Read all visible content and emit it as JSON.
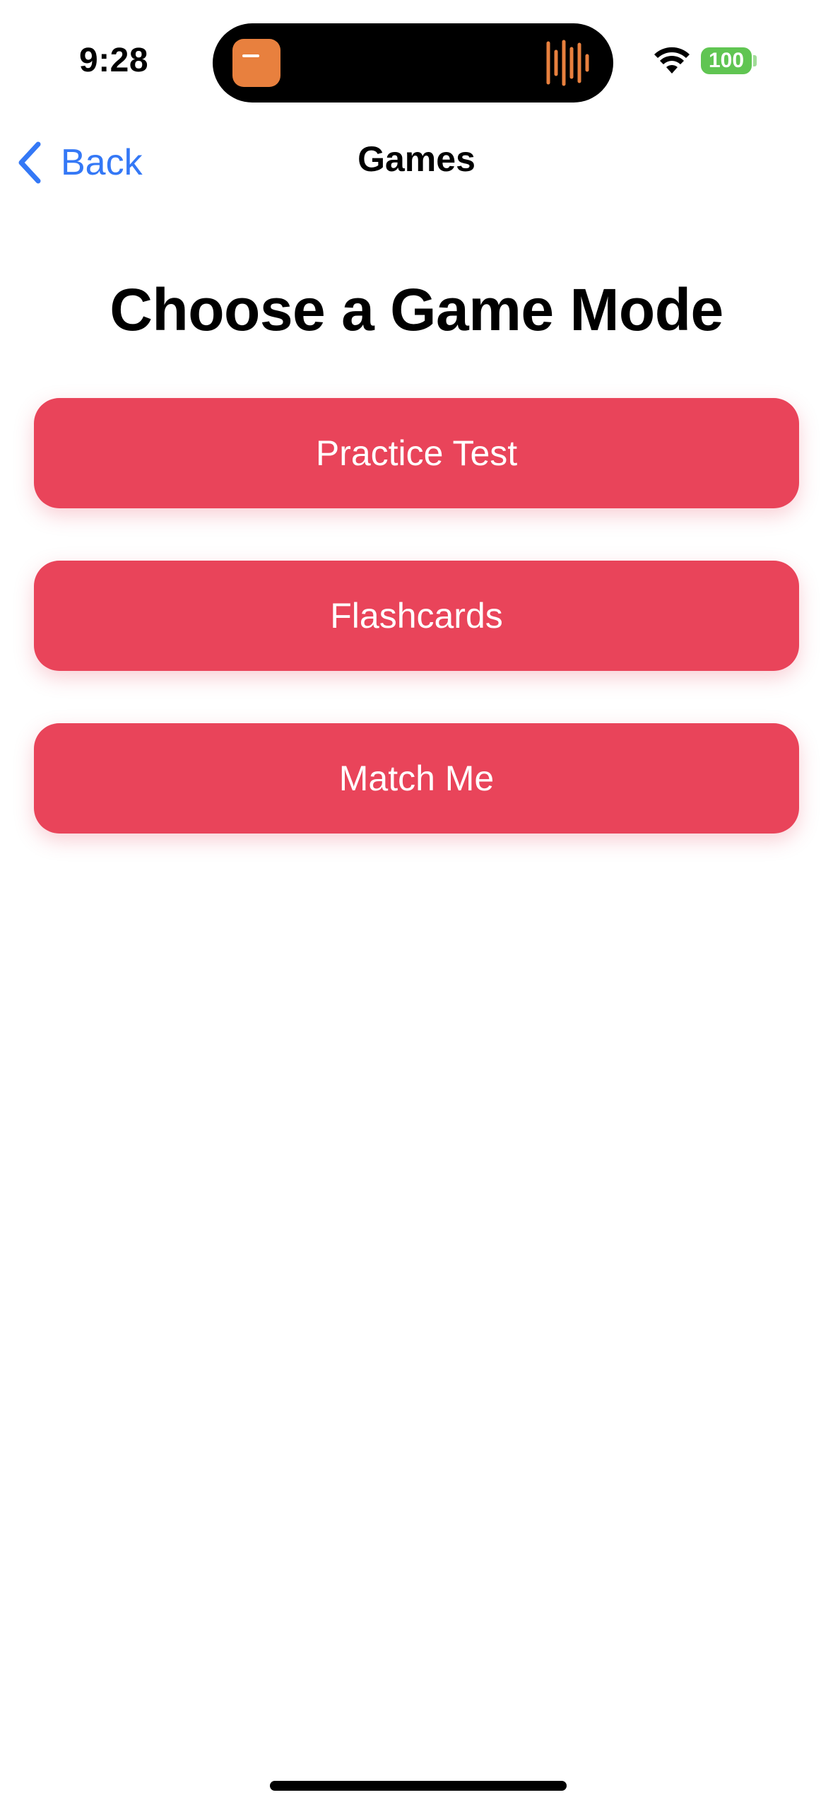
{
  "status_bar": {
    "time": "9:28",
    "battery": "100",
    "battery_color": "#60c552",
    "icons": [
      "wifi-icon",
      "battery-icon"
    ]
  },
  "dynamic_island": {
    "app_icon": "recording-app-icon",
    "activity_icon": "audio-waveform-icon",
    "accent_color": "#e8803e"
  },
  "nav": {
    "back_label": "Back",
    "title": "Games",
    "accent_color": "#3478f6"
  },
  "main": {
    "heading": "Choose a Game Mode",
    "buttons": [
      {
        "label": "Practice Test"
      },
      {
        "label": "Flashcards"
      },
      {
        "label": "Match Me"
      }
    ],
    "button_color": "#e9445a"
  }
}
